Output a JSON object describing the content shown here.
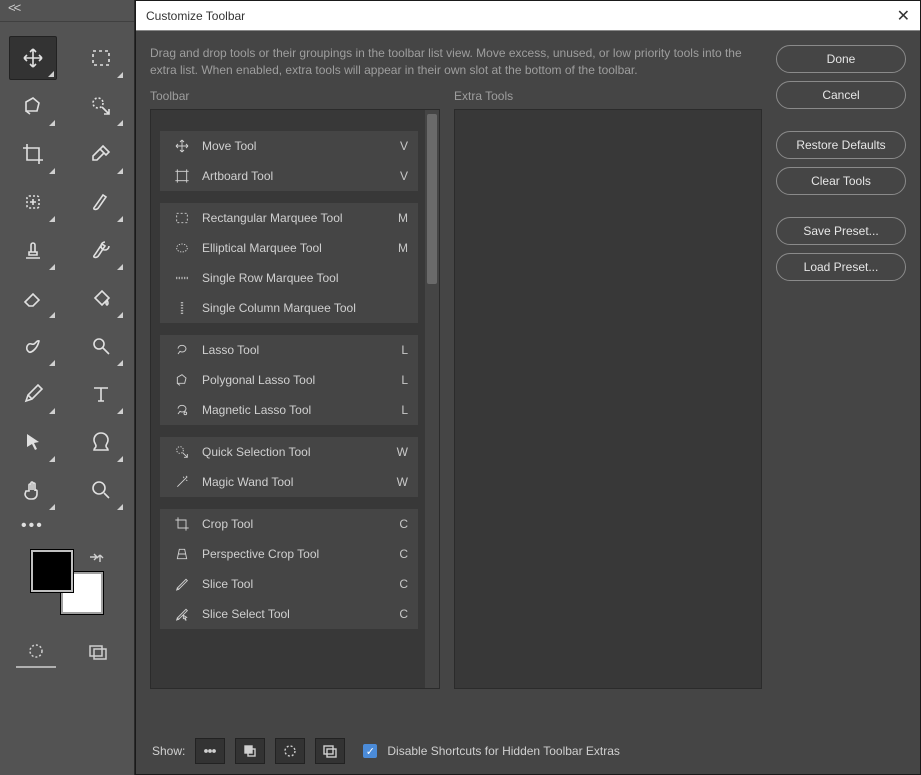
{
  "dialog": {
    "title": "Customize Toolbar",
    "description": "Drag and drop tools or their groupings in the toolbar list view. Move excess, unused, or low priority tools into the extra list. When enabled, extra tools will appear in their own slot at the bottom of the toolbar.",
    "toolbar_header": "Toolbar",
    "extra_header": "Extra Tools",
    "buttons": {
      "done": "Done",
      "cancel": "Cancel",
      "restore": "Restore Defaults",
      "clear": "Clear Tools",
      "save_preset": "Save Preset...",
      "load_preset": "Load Preset..."
    },
    "groups": [
      {
        "tools": [
          {
            "icon": "move",
            "label": "Move Tool",
            "key": "V"
          },
          {
            "icon": "artboard",
            "label": "Artboard Tool",
            "key": "V"
          }
        ]
      },
      {
        "tools": [
          {
            "icon": "rect-marquee",
            "label": "Rectangular Marquee Tool",
            "key": "M"
          },
          {
            "icon": "ellipse-marquee",
            "label": "Elliptical Marquee Tool",
            "key": "M"
          },
          {
            "icon": "row-marquee",
            "label": "Single Row Marquee Tool",
            "key": ""
          },
          {
            "icon": "col-marquee",
            "label": "Single Column Marquee Tool",
            "key": ""
          }
        ]
      },
      {
        "tools": [
          {
            "icon": "lasso",
            "label": "Lasso Tool",
            "key": "L"
          },
          {
            "icon": "poly-lasso",
            "label": "Polygonal Lasso Tool",
            "key": "L"
          },
          {
            "icon": "mag-lasso",
            "label": "Magnetic Lasso Tool",
            "key": "L"
          }
        ]
      },
      {
        "tools": [
          {
            "icon": "quick-select",
            "label": "Quick Selection Tool",
            "key": "W"
          },
          {
            "icon": "magic-wand",
            "label": "Magic Wand Tool",
            "key": "W"
          }
        ]
      },
      {
        "tools": [
          {
            "icon": "crop",
            "label": "Crop Tool",
            "key": "C"
          },
          {
            "icon": "persp-crop",
            "label": "Perspective Crop Tool",
            "key": "C"
          },
          {
            "icon": "slice",
            "label": "Slice Tool",
            "key": "C"
          },
          {
            "icon": "slice-select",
            "label": "Slice Select Tool",
            "key": "C"
          }
        ]
      }
    ],
    "footer": {
      "show_label": "Show:",
      "disable_label": "Disable Shortcuts for Hidden Toolbar Extras",
      "disable_checked": true
    }
  },
  "tool_panel": {
    "tools": [
      {
        "name": "move-tool-icon",
        "selected": true,
        "svg": "move"
      },
      {
        "name": "rect-marquee-tool-icon",
        "svg": "rect-marquee"
      },
      {
        "name": "poly-lasso-tool-icon",
        "svg": "poly-lasso"
      },
      {
        "name": "quick-select-tool-icon",
        "svg": "quick-select"
      },
      {
        "name": "crop-tool-icon",
        "svg": "crop"
      },
      {
        "name": "eyedropper-tool-icon",
        "svg": "eyedropper"
      },
      {
        "name": "healing-brush-tool-icon",
        "svg": "healing"
      },
      {
        "name": "brush-tool-icon",
        "svg": "brush"
      },
      {
        "name": "clone-stamp-tool-icon",
        "svg": "stamp"
      },
      {
        "name": "history-brush-tool-icon",
        "svg": "history-brush"
      },
      {
        "name": "eraser-tool-icon",
        "svg": "eraser"
      },
      {
        "name": "paint-bucket-tool-icon",
        "svg": "bucket"
      },
      {
        "name": "smudge-tool-icon",
        "svg": "smudge"
      },
      {
        "name": "dodge-tool-icon",
        "svg": "dodge"
      },
      {
        "name": "pen-tool-icon",
        "svg": "pen"
      },
      {
        "name": "type-tool-icon",
        "svg": "type"
      },
      {
        "name": "path-select-tool-icon",
        "svg": "path-select"
      },
      {
        "name": "shape-tool-icon",
        "svg": "shape"
      },
      {
        "name": "hand-tool-icon",
        "svg": "hand"
      },
      {
        "name": "zoom-tool-icon",
        "svg": "zoom"
      }
    ]
  }
}
